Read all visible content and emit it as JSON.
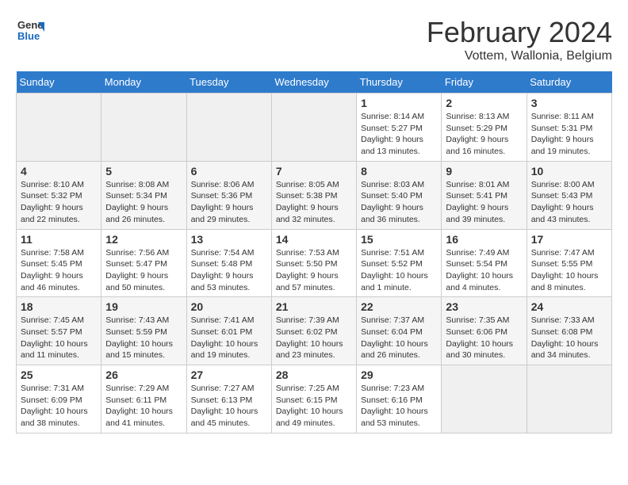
{
  "header": {
    "logo_line1": "General",
    "logo_line2": "Blue",
    "month": "February 2024",
    "location": "Vottem, Wallonia, Belgium"
  },
  "weekdays": [
    "Sunday",
    "Monday",
    "Tuesday",
    "Wednesday",
    "Thursday",
    "Friday",
    "Saturday"
  ],
  "weeks": [
    [
      {
        "day": "",
        "sunrise": "",
        "sunset": "",
        "daylight": "",
        "empty": true
      },
      {
        "day": "",
        "sunrise": "",
        "sunset": "",
        "daylight": "",
        "empty": true
      },
      {
        "day": "",
        "sunrise": "",
        "sunset": "",
        "daylight": "",
        "empty": true
      },
      {
        "day": "",
        "sunrise": "",
        "sunset": "",
        "daylight": "",
        "empty": true
      },
      {
        "day": "1",
        "sunrise": "8:14 AM",
        "sunset": "5:27 PM",
        "daylight": "9 hours and 13 minutes."
      },
      {
        "day": "2",
        "sunrise": "8:13 AM",
        "sunset": "5:29 PM",
        "daylight": "9 hours and 16 minutes."
      },
      {
        "day": "3",
        "sunrise": "8:11 AM",
        "sunset": "5:31 PM",
        "daylight": "9 hours and 19 minutes."
      }
    ],
    [
      {
        "day": "4",
        "sunrise": "8:10 AM",
        "sunset": "5:32 PM",
        "daylight": "9 hours and 22 minutes."
      },
      {
        "day": "5",
        "sunrise": "8:08 AM",
        "sunset": "5:34 PM",
        "daylight": "9 hours and 26 minutes."
      },
      {
        "day": "6",
        "sunrise": "8:06 AM",
        "sunset": "5:36 PM",
        "daylight": "9 hours and 29 minutes."
      },
      {
        "day": "7",
        "sunrise": "8:05 AM",
        "sunset": "5:38 PM",
        "daylight": "9 hours and 32 minutes."
      },
      {
        "day": "8",
        "sunrise": "8:03 AM",
        "sunset": "5:40 PM",
        "daylight": "9 hours and 36 minutes."
      },
      {
        "day": "9",
        "sunrise": "8:01 AM",
        "sunset": "5:41 PM",
        "daylight": "9 hours and 39 minutes."
      },
      {
        "day": "10",
        "sunrise": "8:00 AM",
        "sunset": "5:43 PM",
        "daylight": "9 hours and 43 minutes."
      }
    ],
    [
      {
        "day": "11",
        "sunrise": "7:58 AM",
        "sunset": "5:45 PM",
        "daylight": "9 hours and 46 minutes."
      },
      {
        "day": "12",
        "sunrise": "7:56 AM",
        "sunset": "5:47 PM",
        "daylight": "9 hours and 50 minutes."
      },
      {
        "day": "13",
        "sunrise": "7:54 AM",
        "sunset": "5:48 PM",
        "daylight": "9 hours and 53 minutes."
      },
      {
        "day": "14",
        "sunrise": "7:53 AM",
        "sunset": "5:50 PM",
        "daylight": "9 hours and 57 minutes."
      },
      {
        "day": "15",
        "sunrise": "7:51 AM",
        "sunset": "5:52 PM",
        "daylight": "10 hours and 1 minute."
      },
      {
        "day": "16",
        "sunrise": "7:49 AM",
        "sunset": "5:54 PM",
        "daylight": "10 hours and 4 minutes."
      },
      {
        "day": "17",
        "sunrise": "7:47 AM",
        "sunset": "5:55 PM",
        "daylight": "10 hours and 8 minutes."
      }
    ],
    [
      {
        "day": "18",
        "sunrise": "7:45 AM",
        "sunset": "5:57 PM",
        "daylight": "10 hours and 11 minutes."
      },
      {
        "day": "19",
        "sunrise": "7:43 AM",
        "sunset": "5:59 PM",
        "daylight": "10 hours and 15 minutes."
      },
      {
        "day": "20",
        "sunrise": "7:41 AM",
        "sunset": "6:01 PM",
        "daylight": "10 hours and 19 minutes."
      },
      {
        "day": "21",
        "sunrise": "7:39 AM",
        "sunset": "6:02 PM",
        "daylight": "10 hours and 23 minutes."
      },
      {
        "day": "22",
        "sunrise": "7:37 AM",
        "sunset": "6:04 PM",
        "daylight": "10 hours and 26 minutes."
      },
      {
        "day": "23",
        "sunrise": "7:35 AM",
        "sunset": "6:06 PM",
        "daylight": "10 hours and 30 minutes."
      },
      {
        "day": "24",
        "sunrise": "7:33 AM",
        "sunset": "6:08 PM",
        "daylight": "10 hours and 34 minutes."
      }
    ],
    [
      {
        "day": "25",
        "sunrise": "7:31 AM",
        "sunset": "6:09 PM",
        "daylight": "10 hours and 38 minutes."
      },
      {
        "day": "26",
        "sunrise": "7:29 AM",
        "sunset": "6:11 PM",
        "daylight": "10 hours and 41 minutes."
      },
      {
        "day": "27",
        "sunrise": "7:27 AM",
        "sunset": "6:13 PM",
        "daylight": "10 hours and 45 minutes."
      },
      {
        "day": "28",
        "sunrise": "7:25 AM",
        "sunset": "6:15 PM",
        "daylight": "10 hours and 49 minutes."
      },
      {
        "day": "29",
        "sunrise": "7:23 AM",
        "sunset": "6:16 PM",
        "daylight": "10 hours and 53 minutes."
      },
      {
        "day": "",
        "sunrise": "",
        "sunset": "",
        "daylight": "",
        "empty": true
      },
      {
        "day": "",
        "sunrise": "",
        "sunset": "",
        "daylight": "",
        "empty": true
      }
    ]
  ]
}
